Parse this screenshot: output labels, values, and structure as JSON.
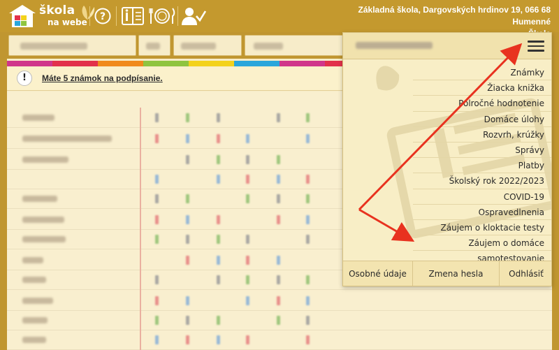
{
  "header": {
    "logo_line1": "škola",
    "logo_line2": "na webe",
    "school_line1": "Základná škola, Dargovských hrdinov 19, 066 68 Humenné",
    "school_line2": "Škola",
    "icons": [
      "help-icon",
      "student-book-icon",
      "dining-icon",
      "user-check-icon"
    ]
  },
  "alert": {
    "icon": "!",
    "text": "Máte 5 známok na podpísanie."
  },
  "menu": {
    "items": [
      "Známky",
      "Žiacka knižka",
      "Polročné hodnotenie",
      "Domáce úlohy",
      "Rozvrh, krúžky",
      "Správy",
      "Platby",
      "Školský rok 2022/2023",
      "COVID-19",
      "Ospravedlnenia",
      "Záujem o kloktacie testy",
      "Záujem o domáce samotestovanie"
    ],
    "footer": [
      "Osobné údaje",
      "Zmena hesla",
      "Odhlásiť"
    ]
  },
  "colors": {
    "topbar": "#c4992e",
    "annotation_arrow": "#e8321f",
    "stripe": [
      "#d0368a",
      "#e2314b",
      "#f08a1c",
      "#8fc43f",
      "#f3d21b",
      "#2aa6db",
      "#d0368a",
      "#e2314b",
      "#f08a1c",
      "#8fc43f",
      "#f3d21b",
      "#2aa6db"
    ]
  }
}
